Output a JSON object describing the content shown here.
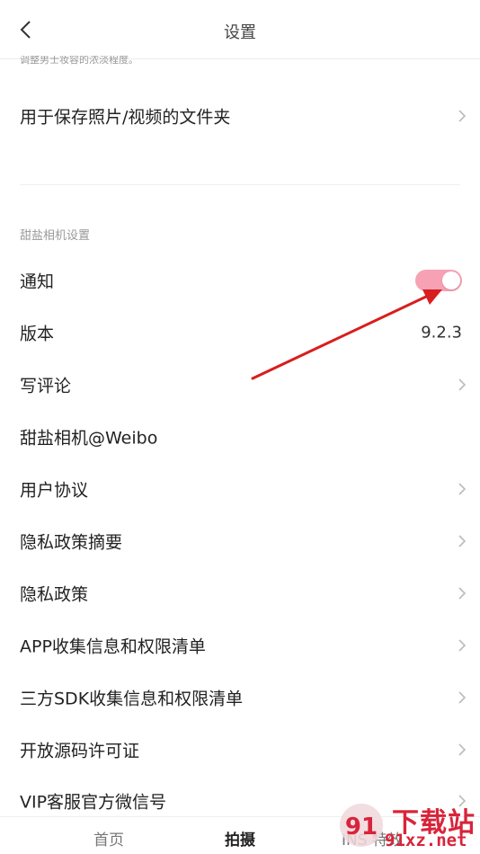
{
  "header": {
    "title": "设置",
    "back_icon": "chevron-left-icon"
  },
  "clipped_hint": "调整男士妆容的浓淡程度。",
  "folder_row": {
    "label": "用于保存照片/视频的文件夹"
  },
  "section": {
    "title": "甜盐相机设置"
  },
  "notify_row": {
    "label": "通知",
    "toggle_on": true,
    "toggle_color": "#f7a1b5"
  },
  "version_row": {
    "label": "版本",
    "value": "9.2.3"
  },
  "rows": [
    {
      "label": "写评论",
      "chevron": true
    },
    {
      "label": "甜盐相机@Weibo",
      "chevron": false
    },
    {
      "label": "用户协议",
      "chevron": true
    },
    {
      "label": "隐私政策摘要",
      "chevron": true
    },
    {
      "label": "隐私政策",
      "chevron": true
    },
    {
      "label": "APP收集信息和权限清单",
      "chevron": true
    },
    {
      "label": "三方SDK收集信息和权限清单",
      "chevron": true
    },
    {
      "label": "开放源码许可证",
      "chevron": true
    },
    {
      "label": "VIP客服官方微信号",
      "chevron": true
    }
  ],
  "bottom_nav": {
    "items": [
      "首页",
      "拍摄",
      "INS 特效"
    ],
    "active": "拍摄"
  },
  "watermark": {
    "cn": "下载站",
    "url": "91xz.net",
    "logo": "91"
  },
  "annotation": {
    "arrow_color": "#e02020"
  }
}
